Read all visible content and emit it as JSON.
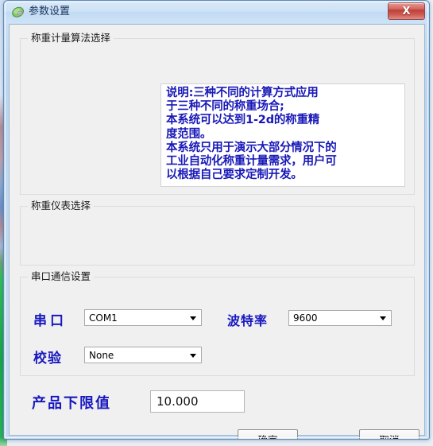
{
  "window": {
    "title": "参数设置",
    "icon": "leaf-icon",
    "close_label": "X",
    "accent_border": "#5e8bb8",
    "close_color": "#bb3f38"
  },
  "groups": {
    "algorithm": {
      "title": "称重计量算法选择",
      "description": "说明:三种不同的计算方式应用\n于三种不同的称重场合;\n本系统可以达到1-2d的称重精\n度范围。\n本系统只用于演示大部分情况下的\n工业自动化称重计量需求，用户可\n以根据自己要求定制开发。",
      "description_color": "#1818b8"
    },
    "meter": {
      "title": "称重仪表选择"
    },
    "serial": {
      "title": "串口通信设置",
      "fields": {
        "port": {
          "label": "串口",
          "value": "COM1"
        },
        "baud": {
          "label": "波特率",
          "value": "9600"
        },
        "parity": {
          "label": "校验",
          "value": "None"
        }
      },
      "label_color": "#1818c0"
    }
  },
  "lower_limit": {
    "label": "产品下限值",
    "value": "10.000"
  },
  "buttons": {
    "ok": "确定",
    "cancel": "取消"
  }
}
